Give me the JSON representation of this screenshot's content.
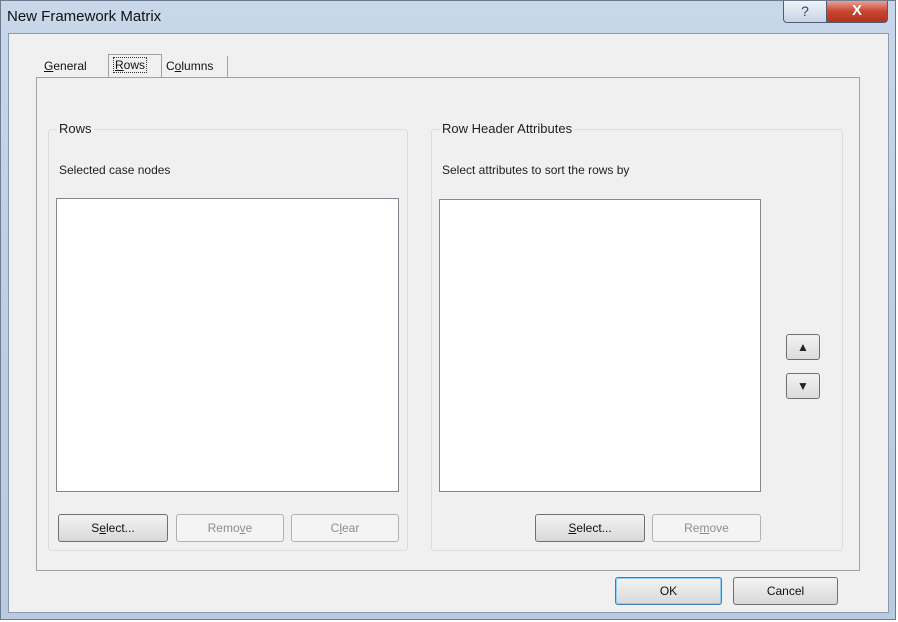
{
  "window": {
    "title": "New Framework Matrix",
    "help_glyph": "?",
    "close_glyph": "X"
  },
  "tabs": [
    {
      "label": "General",
      "underline": "G",
      "rest": "eneral"
    },
    {
      "label": "Rows",
      "underline": "R",
      "rest": "ows"
    },
    {
      "label": "Columns",
      "pre": "C",
      "underline": "o",
      "rest": "lumns"
    }
  ],
  "rows_group": {
    "title": "Rows",
    "caption": "Selected case nodes",
    "buttons": {
      "select": {
        "pre": "S",
        "u": "e",
        "post": "lect...",
        "label": "Select..."
      },
      "remove": {
        "pre": "Remo",
        "u": "v",
        "post": "e",
        "label": "Remove"
      },
      "clear": {
        "pre": "C",
        "u": "l",
        "post": "ear",
        "label": "Clear"
      }
    }
  },
  "attrs_group": {
    "title": "Row Header Attributes",
    "caption": "Select attributes to sort the rows by",
    "buttons": {
      "select": {
        "pre": "",
        "u": "S",
        "post": "elect...",
        "label": "Select..."
      },
      "remove": {
        "pre": "Re",
        "u": "m",
        "post": "ove",
        "label": "Remove"
      }
    },
    "move_up_glyph": "▲",
    "move_down_glyph": "▼"
  },
  "footer": {
    "ok_label": "OK",
    "cancel_label": "Cancel"
  },
  "icons": {
    "help": "help-icon",
    "close": "close-icon",
    "up": "arrow-up-icon",
    "down": "arrow-down-icon"
  }
}
